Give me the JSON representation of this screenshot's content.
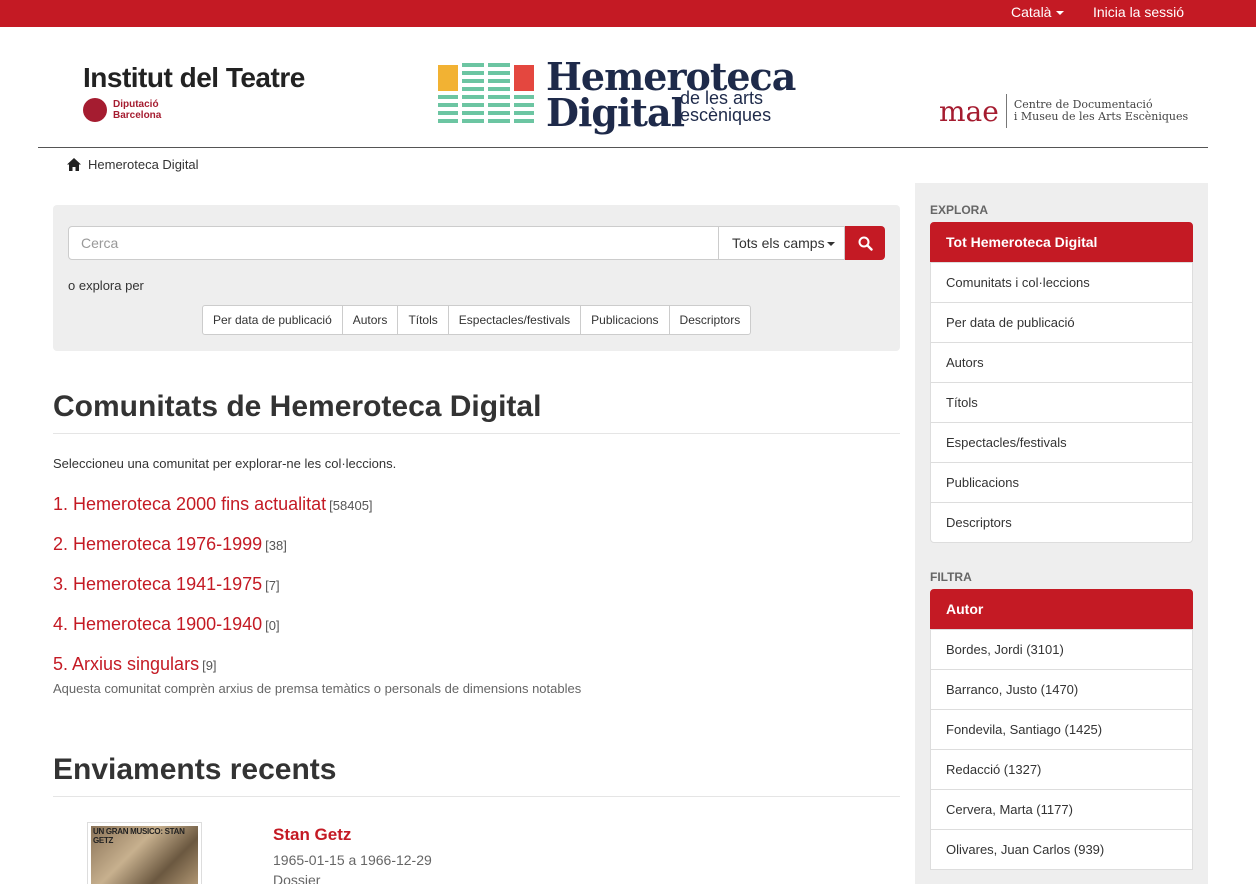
{
  "topbar": {
    "language": "Català",
    "login": "Inicia la sessió"
  },
  "header": {
    "left_logo": {
      "title": "Institut del Teatre",
      "sub_line1": "Diputació",
      "sub_line2": "Barcelona"
    },
    "center_logo": {
      "line1": "Hemeroteca",
      "line2": "Digital",
      "tag_line1": "de les arts",
      "tag_line2": "escèniques"
    },
    "right_logo": {
      "mark": "mae",
      "line1": "Centre de Documentació",
      "line2": "i Museu de les Arts Escèniques"
    }
  },
  "breadcrumb": {
    "home_label": "Hemeroteca Digital"
  },
  "search": {
    "placeholder": "Cerca",
    "scope": "Tots els camps",
    "explore_label": "o explora per",
    "browse_buttons": [
      "Per data de publicació",
      "Autors",
      "Títols",
      "Espectacles/festivals",
      "Publicacions",
      "Descriptors"
    ]
  },
  "communities": {
    "heading": "Comunitats de Hemeroteca Digital",
    "intro": "Seleccioneu una comunitat per explorar-ne les col·leccions.",
    "items": [
      {
        "label": "1. Hemeroteca 2000 fins actualitat",
        "count": "[58405]"
      },
      {
        "label": "2. Hemeroteca 1976-1999",
        "count": "[38]"
      },
      {
        "label": "3. Hemeroteca 1941-1975",
        "count": "[7]"
      },
      {
        "label": "4. Hemeroteca 1900-1940",
        "count": "[0]"
      },
      {
        "label": "5. Arxius singulars",
        "count": "[9]"
      }
    ],
    "last_description": "Aquesta comunitat comprèn arxius de premsa temàtics o personals de dimensions notables"
  },
  "recent": {
    "heading": "Enviaments recents",
    "items": [
      {
        "thumb_caption": "UN GRAN MUSICO: STAN GETZ",
        "title": "Stan Getz",
        "date": "1965-01-15 a 1966-12-29",
        "type": "Dossier"
      }
    ]
  },
  "sidebar": {
    "explore_heading": "Explora",
    "explore_items": [
      "Tot Hemeroteca Digital",
      "Comunitats i col·leccions",
      "Per data de publicació",
      "Autors",
      "Títols",
      "Espectacles/festivals",
      "Publicacions",
      "Descriptors"
    ],
    "filter_heading": "Filtra",
    "filter_items": [
      "Autor",
      "Bordes, Jordi (3101)",
      "Barranco, Justo (1470)",
      "Fondevila, Santiago (1425)",
      "Redacció (1327)",
      "Cervera, Marta (1177)",
      "Olivares, Juan Carlos (939)"
    ]
  },
  "colors": {
    "brand_red": "#c41a24",
    "navy": "#1e2a4a",
    "panel_grey": "#eeeeee"
  }
}
